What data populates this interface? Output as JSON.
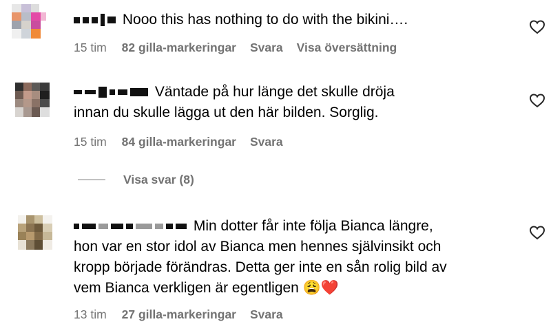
{
  "comments": [
    {
      "text": "Nooo this has nothing to do with the bikini….",
      "time": "15 tim",
      "likes": "82 gilla-markeringar",
      "reply": "Svara",
      "translate": "Visa översättning"
    },
    {
      "text_line1": "Väntade på hur länge det skulle dröja",
      "text_line2": "innan du skulle lägga ut den här bilden. Sorglig.",
      "time": "15 tim",
      "likes": "84 gilla-markeringar",
      "reply": "Svara"
    },
    {
      "text_line1": "Min dotter får inte följa Bianca längre,",
      "text_line2": "hon var en stor idol av Bianca men hennes självinsikt och",
      "text_line3": "kropp började förändras. Detta ger inte en sån rolig bild av",
      "text_line4": "vem Bianca verkligen är egentligen",
      "emoji": "😩❤️",
      "time": "13 tim",
      "likes": "27 gilla-markeringar",
      "reply": "Svara"
    }
  ],
  "view_replies": "Visa svar (8)",
  "icons": {
    "like": "heart-icon"
  },
  "colors": {
    "meta": "#737373",
    "text": "#000000"
  }
}
